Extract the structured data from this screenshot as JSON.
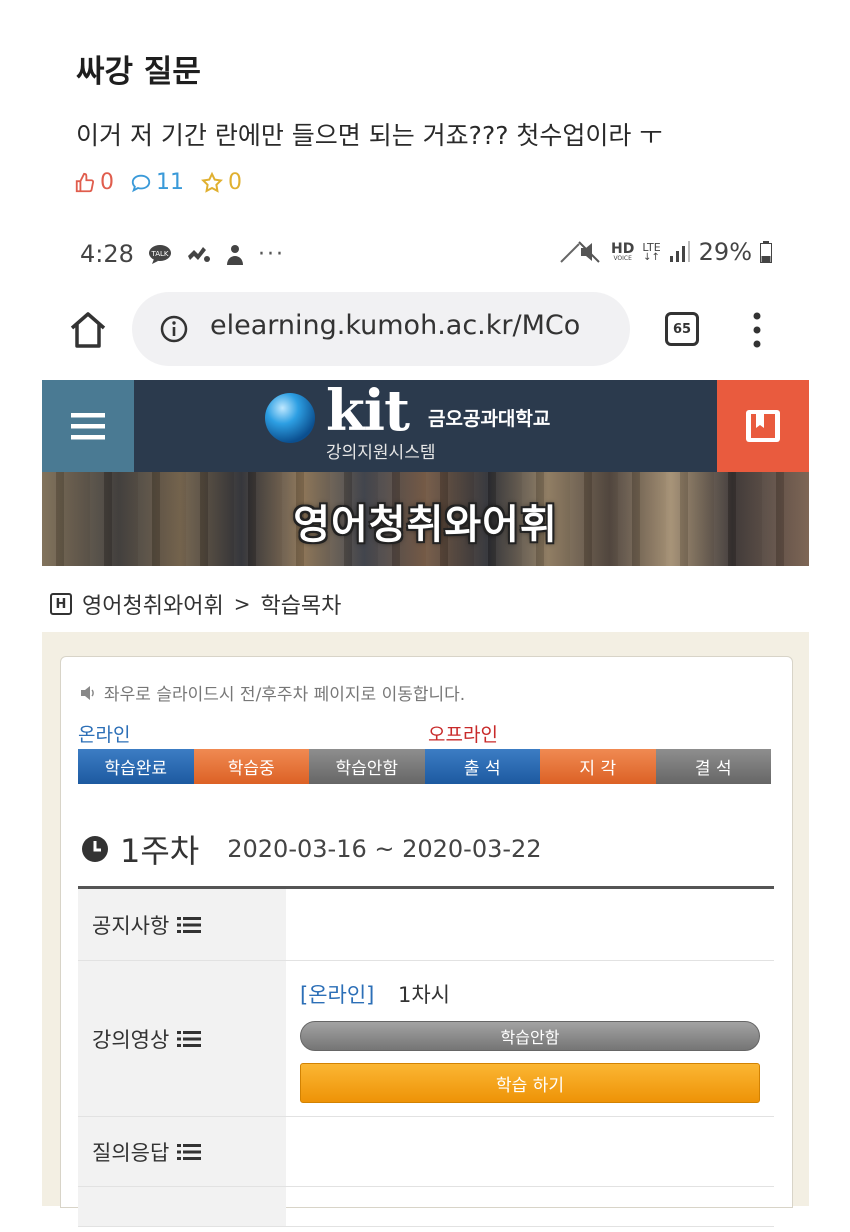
{
  "post": {
    "title": "싸강 질문",
    "body": "이거 저 기간 란에만 들으면 되는 거죠??? 첫수업이라 ㅜ",
    "likes": "0",
    "comments": "11",
    "scraps": "0",
    "icons": [
      "thumbs-up-icon",
      "comment-icon",
      "star-icon"
    ]
  },
  "statusbar": {
    "time": "4:28",
    "dots": "···",
    "hd": "HD",
    "lte": "LTE",
    "battery": "29%"
  },
  "browser": {
    "url": "elearning.kumoh.ac.kr/MCo",
    "tab_count": "65"
  },
  "site": {
    "logo_text": "kit",
    "university": "금오공과대학교",
    "system_name": "강의지원시스템",
    "course_title": "영어청취와어휘"
  },
  "breadcrumb": {
    "home_glyph": "H",
    "course": "영어청취와어휘",
    "separator": ">",
    "current": "학습목차"
  },
  "toc": {
    "notice": "좌우로 슬라이드시 전/후주차 페이지로 이동합니다.",
    "online_label": "온라인",
    "offline_label": "오프라인",
    "legend": {
      "done": "학습완료",
      "in_progress": "학습중",
      "not_started": "학습안함",
      "present": "출 석",
      "late": "지 각",
      "absent": "결 석"
    },
    "week": {
      "label": "1주차",
      "range": "2020-03-16 ~ 2020-03-22"
    },
    "rows": {
      "notice_label": "공지사항",
      "lecture_label": "강의영상",
      "qna_label": "질의응답"
    },
    "lecture": {
      "tag": "[온라인]",
      "session": "1차시",
      "status": "학습안함",
      "button": "학습 하기"
    }
  },
  "colors": {
    "header_bg": "#2b3a4d",
    "hamburger_bg": "#4a7a93",
    "bookmark_bg": "#e95b3e",
    "online_blue": "#2c6fb7",
    "offline_red": "#c82a2a",
    "study_button": "#f5a31a"
  }
}
